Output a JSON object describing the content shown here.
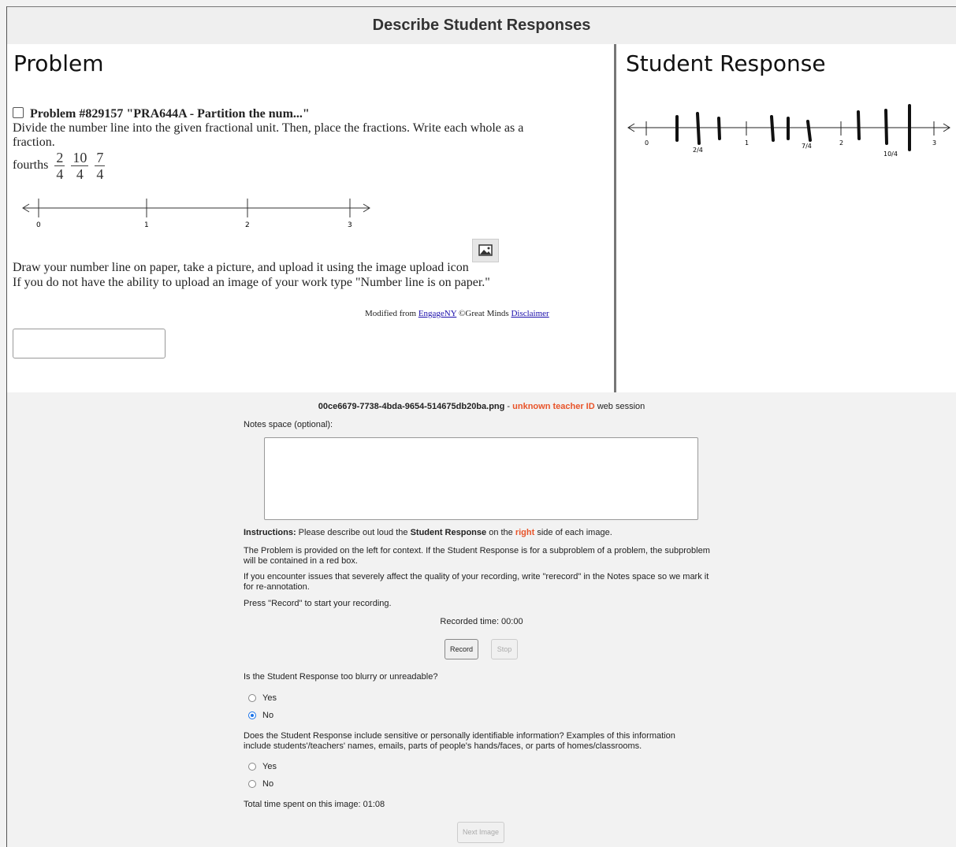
{
  "header": {
    "title": "Describe Student Responses"
  },
  "problem": {
    "title": "Problem",
    "heading": "Problem #829157 \"PRA644A - Partition the num...\"",
    "text": "Divide the number line into the given fractional unit. Then, place the fractions. Write each whole as a fraction.",
    "unit_label": "fourths",
    "fractions": [
      {
        "num": "2",
        "den": "4"
      },
      {
        "num": "10",
        "den": "4"
      },
      {
        "num": "7",
        "den": "4"
      }
    ],
    "number_line_labels": [
      "0",
      "1",
      "2",
      "3"
    ],
    "upload_text": "Draw your number line on paper, take a picture, and upload it using the image upload icon",
    "paper_text": "If you do not have the ability to upload an image of your work type \"Number line is on paper.\"",
    "credit_prefix": "Modified from",
    "credit_link": "EngageNY",
    "credit_mid": "©Great Minds",
    "credit_disclaimer": "Disclaimer"
  },
  "student_response": {
    "title": "Student Response",
    "whole_labels": [
      "0",
      "1",
      "2",
      "3"
    ],
    "fraction_labels": [
      "2/4",
      "7/4",
      "10/4"
    ]
  },
  "session": {
    "filename": "00ce6679-7738-4bda-9654-514675db20ba.png",
    "separator": " - ",
    "teacher": "unknown teacher ID",
    "suffix": " web session"
  },
  "notes_label": "Notes space (optional):",
  "instructions": {
    "label": "Instructions:",
    "p1_a": " Please describe out loud the ",
    "p1_b": "Student Response",
    "p1_c": " on the ",
    "p1_d": "right",
    "p1_e": " side of each image.",
    "p2": "The Problem is provided on the left for context. If the Student Response is for a subproblem of a problem, the subproblem will be contained in a red box.",
    "p3": "If you encounter issues that severely affect the quality of your recording, write \"rerecord\" in the Notes space so we mark it for re-annotation.",
    "p4": "Press \"Record\" to start your recording."
  },
  "recorded_time": "Recorded time: 00:00",
  "record_label": "Record",
  "stop_label": "Stop",
  "q1": {
    "question": "Is the Student Response too blurry or unreadable?",
    "options": [
      "Yes",
      "No"
    ],
    "selected": "No"
  },
  "q2": {
    "question": "Does the Student Response include sensitive or personally identifiable information? Examples of this information include students'/teachers' names, emails, parts of people's hands/faces, or parts of homes/classrooms.",
    "options": [
      "Yes",
      "No"
    ],
    "selected": ""
  },
  "total_time": "Total time spent on this image: 01:08",
  "next_label": "Next Image",
  "colors": {
    "accent": "#e8542a",
    "link": "#1a0dab",
    "radio": "#1a73e8"
  }
}
